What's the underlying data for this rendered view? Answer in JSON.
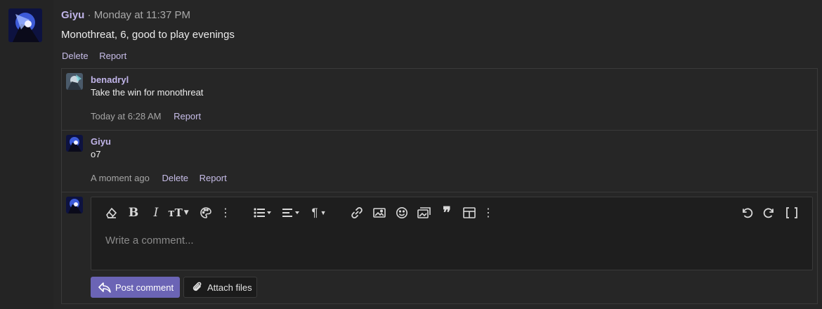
{
  "post": {
    "author": "Giyu",
    "separator": "·",
    "timestamp": "Monday at 11:37 PM",
    "body": "Monothreat, 6, good to play evenings",
    "actions": {
      "delete": "Delete",
      "report": "Report"
    }
  },
  "comments": [
    {
      "author": "benadryl",
      "text": "Take the win for monothreat",
      "time": "Today at 6:28 AM",
      "report": "Report"
    },
    {
      "author": "Giyu",
      "text": "o7",
      "time": "A moment ago",
      "delete": "Delete",
      "report": "Report"
    }
  ],
  "editor": {
    "placeholder": "Write a comment...",
    "toolbar": [
      "eraser-icon",
      "bold-icon",
      "italic-icon",
      "text-size-icon",
      "palette-icon",
      "more-icon",
      "list-icon",
      "align-icon",
      "paragraph-icon",
      "link-icon",
      "image-icon",
      "emoji-icon",
      "media-icon",
      "quote-icon",
      "table-icon",
      "more-icon",
      "undo-icon",
      "redo-icon",
      "fullscreen-icon"
    ]
  },
  "buttons": {
    "post_comment": "Post comment",
    "attach_files": "Attach files"
  },
  "colors": {
    "accent": "#6b64b5",
    "author": "#c0b4e8",
    "link": "#c7bde8"
  }
}
